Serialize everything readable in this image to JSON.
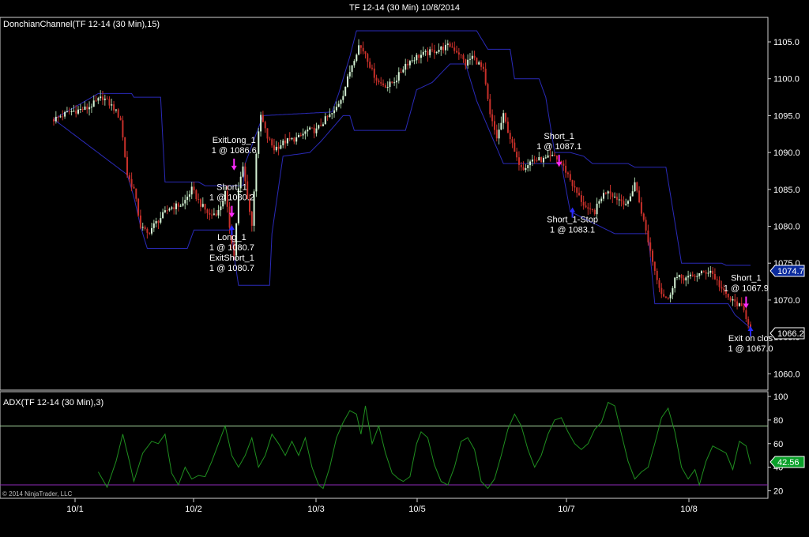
{
  "window_title": "TF 12-14 (30 Min)  10/8/2014",
  "price_panel": {
    "label": "DonchianChannel(TF 12-14 (30 Min),15)",
    "last_upper_badge": "1074.7",
    "last_price_badge": "1066.2"
  },
  "adx_panel": {
    "label": "ADX(TF 12-14 (30 Min),3)",
    "value_badge": "42.56"
  },
  "copyright": "© 2014 NinjaTrader, LLC",
  "colors": {
    "background": "#000000",
    "up_candle": "#d6f2d6",
    "down_candle": "#c8302a",
    "donchian": "#2a2ab8",
    "adx_line": "#1f8f1f",
    "adx_level_high": "#a8d8a0",
    "adx_level_low": "#8e2ab8",
    "buy_arrow": "#2a2aff",
    "sell_arrow": "#ff2aff",
    "badge_blue": "#0a2a9c",
    "badge_green": "#0aa02a"
  },
  "chart_data": [
    {
      "type": "candlestick",
      "title": "DonchianChannel(TF 12-14 (30 Min),15)",
      "x_tick_labels": [
        "10/1",
        "10/2",
        "10/3",
        "10/5",
        "10/7",
        "10/8"
      ],
      "y_tick_labels": [
        "1060.0",
        "1065.0",
        "1070.0",
        "1075.0",
        "1080.0",
        "1085.0",
        "1090.0",
        "1095.0",
        "1100.0",
        "1105.0"
      ],
      "ylim": [
        1058.0,
        1108.0
      ],
      "price_path": [
        [
          0,
          1094.5
        ],
        [
          7,
          1095.5
        ],
        [
          15,
          1096.0
        ],
        [
          22,
          1097.5
        ],
        [
          27,
          1096.0
        ],
        [
          30,
          1094.5
        ],
        [
          33,
          1087.0
        ],
        [
          36,
          1085.0
        ],
        [
          39,
          1080.0
        ],
        [
          42,
          1079.0
        ],
        [
          46,
          1080.5
        ],
        [
          52,
          1082.5
        ],
        [
          58,
          1083.0
        ],
        [
          62,
          1085.0
        ],
        [
          66,
          1083.0
        ],
        [
          70,
          1081.5
        ],
        [
          74,
          1082.0
        ],
        [
          77,
          1084.5
        ],
        [
          79,
          1080.0
        ],
        [
          81,
          1076.0
        ],
        [
          83,
          1085.0
        ],
        [
          85,
          1088.0
        ],
        [
          87,
          1084.0
        ],
        [
          89,
          1080.0
        ],
        [
          91,
          1090.0
        ],
        [
          93,
          1095.0
        ],
        [
          96,
          1092.0
        ],
        [
          99,
          1090.5
        ],
        [
          104,
          1091.5
        ],
        [
          110,
          1092.0
        ],
        [
          114,
          1093.0
        ],
        [
          118,
          1093.0
        ],
        [
          122,
          1094.5
        ],
        [
          126,
          1095.5
        ],
        [
          130,
          1098.0
        ],
        [
          134,
          1102.0
        ],
        [
          137,
          1104.5
        ],
        [
          140,
          1103.5
        ],
        [
          143,
          1101.0
        ],
        [
          146,
          1099.5
        ],
        [
          150,
          1099.0
        ],
        [
          154,
          1100.0
        ],
        [
          158,
          1102.0
        ],
        [
          163,
          1103.0
        ],
        [
          168,
          1103.5
        ],
        [
          173,
          1104.0
        ],
        [
          178,
          1104.5
        ],
        [
          182,
          1103.5
        ],
        [
          185,
          1102.0
        ],
        [
          188,
          1103.0
        ],
        [
          191,
          1102.0
        ],
        [
          193,
          1101.0
        ],
        [
          196,
          1095.0
        ],
        [
          199,
          1092.0
        ],
        [
          202,
          1095.0
        ],
        [
          205,
          1092.0
        ],
        [
          208,
          1089.0
        ],
        [
          211,
          1088.0
        ],
        [
          215,
          1089.0
        ],
        [
          220,
          1089.0
        ],
        [
          225,
          1089.5
        ],
        [
          228,
          1088.5
        ],
        [
          231,
          1087.0
        ],
        [
          234,
          1085.0
        ],
        [
          237,
          1083.5
        ],
        [
          240,
          1082.0
        ],
        [
          243,
          1082.0
        ],
        [
          246,
          1084.0
        ],
        [
          249,
          1085.0
        ],
        [
          252,
          1084.0
        ],
        [
          255,
          1083.5
        ],
        [
          258,
          1083.0
        ],
        [
          261,
          1086.0
        ],
        [
          264,
          1082.0
        ],
        [
          267,
          1078.0
        ],
        [
          270,
          1074.0
        ],
        [
          273,
          1071.0
        ],
        [
          276,
          1070.0
        ],
        [
          279,
          1073.0
        ],
        [
          285,
          1073.0
        ],
        [
          290,
          1073.5
        ],
        [
          295,
          1074.0
        ],
        [
          298,
          1072.5
        ],
        [
          301,
          1071.0
        ],
        [
          304,
          1070.0
        ],
        [
          307,
          1069.5
        ],
        [
          310,
          1068.5
        ],
        [
          313,
          1066.2
        ]
      ],
      "bars_count": 314,
      "donchian_upper": [
        [
          0,
          1094.5
        ],
        [
          20,
          1098.0
        ],
        [
          35,
          1098.0
        ],
        [
          36,
          1097.5
        ],
        [
          48,
          1097.5
        ],
        [
          50,
          1086.0
        ],
        [
          65,
          1086.0
        ],
        [
          68,
          1085.5
        ],
        [
          85,
          1085.5
        ],
        [
          86,
          1088.5
        ],
        [
          94,
          1095.0
        ],
        [
          125,
          1095.5
        ],
        [
          128,
          1098.0
        ],
        [
          133,
          1103.0
        ],
        [
          136,
          1106.5
        ],
        [
          182,
          1106.5
        ],
        [
          190,
          1106.5
        ],
        [
          195,
          1104.0
        ],
        [
          205,
          1104.0
        ],
        [
          207,
          1100.0
        ],
        [
          218,
          1100.0
        ],
        [
          221,
          1097.5
        ],
        [
          225,
          1090.0
        ],
        [
          232,
          1090.0
        ],
        [
          238,
          1089.5
        ],
        [
          242,
          1088.5
        ],
        [
          258,
          1088.5
        ],
        [
          261,
          1088.0
        ],
        [
          275,
          1088.0
        ],
        [
          282,
          1075.0
        ],
        [
          300,
          1075.0
        ],
        [
          302,
          1074.7
        ],
        [
          313,
          1074.7
        ]
      ],
      "donchian_lower": [
        [
          0,
          1094.5
        ],
        [
          33,
          1087.0
        ],
        [
          36,
          1084.0
        ],
        [
          39,
          1080.0
        ],
        [
          42,
          1077.0
        ],
        [
          60,
          1077.0
        ],
        [
          63,
          1079.5
        ],
        [
          80,
          1079.5
        ],
        [
          81,
          1076.0
        ],
        [
          83,
          1072.0
        ],
        [
          97,
          1072.0
        ],
        [
          98,
          1079.0
        ],
        [
          103,
          1089.5
        ],
        [
          115,
          1090.0
        ],
        [
          120,
          1091.5
        ],
        [
          130,
          1095.0
        ],
        [
          133,
          1095.0
        ],
        [
          135,
          1093.0
        ],
        [
          158,
          1093.0
        ],
        [
          163,
          1098.5
        ],
        [
          170,
          1099.5
        ],
        [
          178,
          1102.0
        ],
        [
          185,
          1102.0
        ],
        [
          190,
          1097.0
        ],
        [
          202,
          1088.5
        ],
        [
          228,
          1088.5
        ],
        [
          232,
          1082.0
        ],
        [
          252,
          1079.0
        ],
        [
          267,
          1079.0
        ],
        [
          270,
          1069.5
        ],
        [
          280,
          1069.5
        ],
        [
          303,
          1069.5
        ],
        [
          306,
          1068.0
        ],
        [
          313,
          1066.2
        ]
      ],
      "annotations": [
        {
          "bar": 81,
          "price": 1086.6,
          "text": [
            "ExitLong_1",
            "1 @ 1086.6"
          ],
          "arrow": "sell",
          "side": "above"
        },
        {
          "bar": 80,
          "price": 1080.2,
          "text": [
            "Short_1",
            "1 @ 1080.2"
          ],
          "arrow": "sell",
          "side": "above"
        },
        {
          "bar": 80,
          "price": 1080.7,
          "text": [
            "Long_1",
            "1 @ 1080.7"
          ],
          "arrow": "buy",
          "side": "below"
        },
        {
          "bar": 80,
          "price": 1080.7,
          "text": [
            "ExitShort_1",
            "1 @ 1080.7"
          ],
          "arrow": "none",
          "side": "below2"
        },
        {
          "bar": 227,
          "price": 1087.1,
          "text": [
            "Short_1",
            "1 @ 1087.1"
          ],
          "arrow": "sell",
          "side": "above"
        },
        {
          "bar": 233,
          "price": 1083.1,
          "text": [
            "Short_1-Stop",
            "1 @ 1083.1"
          ],
          "arrow": "buy",
          "side": "below"
        },
        {
          "bar": 311,
          "price": 1067.9,
          "text": [
            "Short_1",
            "1 @ 1067.9"
          ],
          "arrow": "sell",
          "side": "above"
        },
        {
          "bar": 313,
          "price": 1067.0,
          "text": [
            "Exit on clos",
            "1 @ 1067.0"
          ],
          "arrow": "buy",
          "side": "below"
        }
      ]
    },
    {
      "type": "line",
      "title": "ADX(TF 12-14 (30 Min),3)",
      "y_tick_labels": [
        "20",
        "40",
        "60",
        "80",
        "100"
      ],
      "ylim": [
        15,
        102
      ],
      "levels": [
        75,
        25
      ],
      "series": [
        {
          "name": "ADX",
          "points": [
            [
              20,
              36
            ],
            [
              24,
              23
            ],
            [
              28,
              45
            ],
            [
              31,
              68
            ],
            [
              34,
              45
            ],
            [
              36,
              28
            ],
            [
              40,
              52
            ],
            [
              44,
              62
            ],
            [
              47,
              60
            ],
            [
              50,
              68
            ],
            [
              53,
              35
            ],
            [
              56,
              25
            ],
            [
              59,
              40
            ],
            [
              62,
              30
            ],
            [
              65,
              33
            ],
            [
              68,
              32
            ],
            [
              71,
              45
            ],
            [
              74,
              60
            ],
            [
              77,
              75
            ],
            [
              80,
              50
            ],
            [
              83,
              40
            ],
            [
              86,
              50
            ],
            [
              89,
              65
            ],
            [
              92,
              40
            ],
            [
              95,
              50
            ],
            [
              98,
              68
            ],
            [
              101,
              60
            ],
            [
              104,
              50
            ],
            [
              107,
              62
            ],
            [
              110,
              50
            ],
            [
              113,
              65
            ],
            [
              116,
              40
            ],
            [
              119,
              25
            ],
            [
              121,
              22
            ],
            [
              124,
              40
            ],
            [
              127,
              65
            ],
            [
              130,
              78
            ],
            [
              133,
              88
            ],
            [
              136,
              85
            ],
            [
              138,
              68
            ],
            [
              140,
              92
            ],
            [
              143,
              60
            ],
            [
              146,
              75
            ],
            [
              149,
              52
            ],
            [
              152,
              35
            ],
            [
              155,
              30
            ],
            [
              157,
              28
            ],
            [
              160,
              32
            ],
            [
              163,
              60
            ],
            [
              165,
              70
            ],
            [
              168,
              65
            ],
            [
              171,
              42
            ],
            [
              174,
              28
            ],
            [
              177,
              25
            ],
            [
              180,
              40
            ],
            [
              183,
              62
            ],
            [
              186,
              65
            ],
            [
              189,
              55
            ],
            [
              192,
              28
            ],
            [
              195,
              22
            ],
            [
              198,
              30
            ],
            [
              201,
              50
            ],
            [
              204,
              72
            ],
            [
              207,
              85
            ],
            [
              210,
              75
            ],
            [
              213,
              55
            ],
            [
              216,
              40
            ],
            [
              219,
              50
            ],
            [
              222,
              68
            ],
            [
              225,
              80
            ],
            [
              228,
              82
            ],
            [
              231,
              70
            ],
            [
              234,
              60
            ],
            [
              237,
              55
            ],
            [
              240,
              60
            ],
            [
              243,
              72
            ],
            [
              246,
              78
            ],
            [
              249,
              95
            ],
            [
              252,
              92
            ],
            [
              255,
              68
            ],
            [
              258,
              45
            ],
            [
              261,
              30
            ],
            [
              264,
              36
            ],
            [
              267,
              40
            ],
            [
              270,
              60
            ],
            [
              273,
              82
            ],
            [
              276,
              90
            ],
            [
              279,
              70
            ],
            [
              282,
              40
            ],
            [
              285,
              30
            ],
            [
              288,
              38
            ],
            [
              290,
              25
            ],
            [
              293,
              45
            ],
            [
              296,
              58
            ],
            [
              299,
              55
            ],
            [
              302,
              52
            ],
            [
              305,
              38
            ],
            [
              308,
              62
            ],
            [
              311,
              58
            ],
            [
              313,
              42.56
            ]
          ]
        }
      ]
    }
  ]
}
